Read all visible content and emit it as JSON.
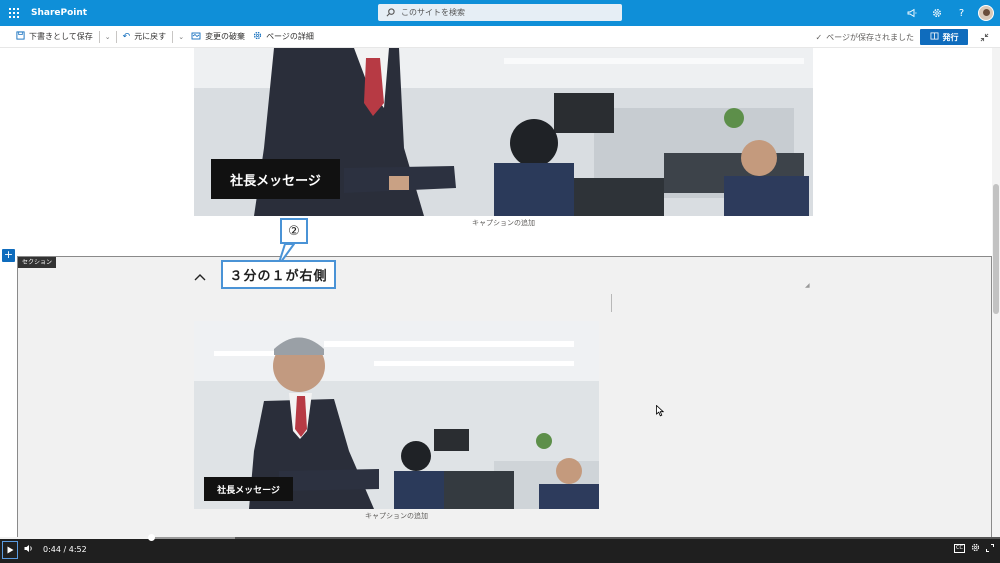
{
  "suitebar": {
    "app_name": "SharePoint",
    "search_placeholder": "このサイトを検索",
    "icons": [
      "waffle-icon",
      "megaphone-icon",
      "gear-icon",
      "help-icon",
      "avatar"
    ],
    "help_glyph": "?",
    "accent": "#0f8fd8"
  },
  "command_bar": {
    "save_draft": "下書きとして保存",
    "undo": "元に戻す",
    "discard": "変更の破棄",
    "page_details": "ページの詳細",
    "saved_status": "ページが保存されました",
    "publish": "発行",
    "publish_color": "#0f6cbd"
  },
  "canvas": {
    "hero_top": {
      "title": "社長メッセージ",
      "caption": "キャプションの追加"
    },
    "section": {
      "tag": "セクション",
      "add_glyph": "+"
    },
    "hero_bottom": {
      "title": "社長メッセージ",
      "caption": "キャプションの追加"
    }
  },
  "annotation": {
    "number": "②",
    "label": "３分の１が右側",
    "border_color": "#4a93d6"
  },
  "player": {
    "current_time": "0:44",
    "separator": "/",
    "duration": "4:52",
    "played_fraction": 0.151,
    "buffered_fraction": 0.235,
    "cc_label": "CC"
  }
}
